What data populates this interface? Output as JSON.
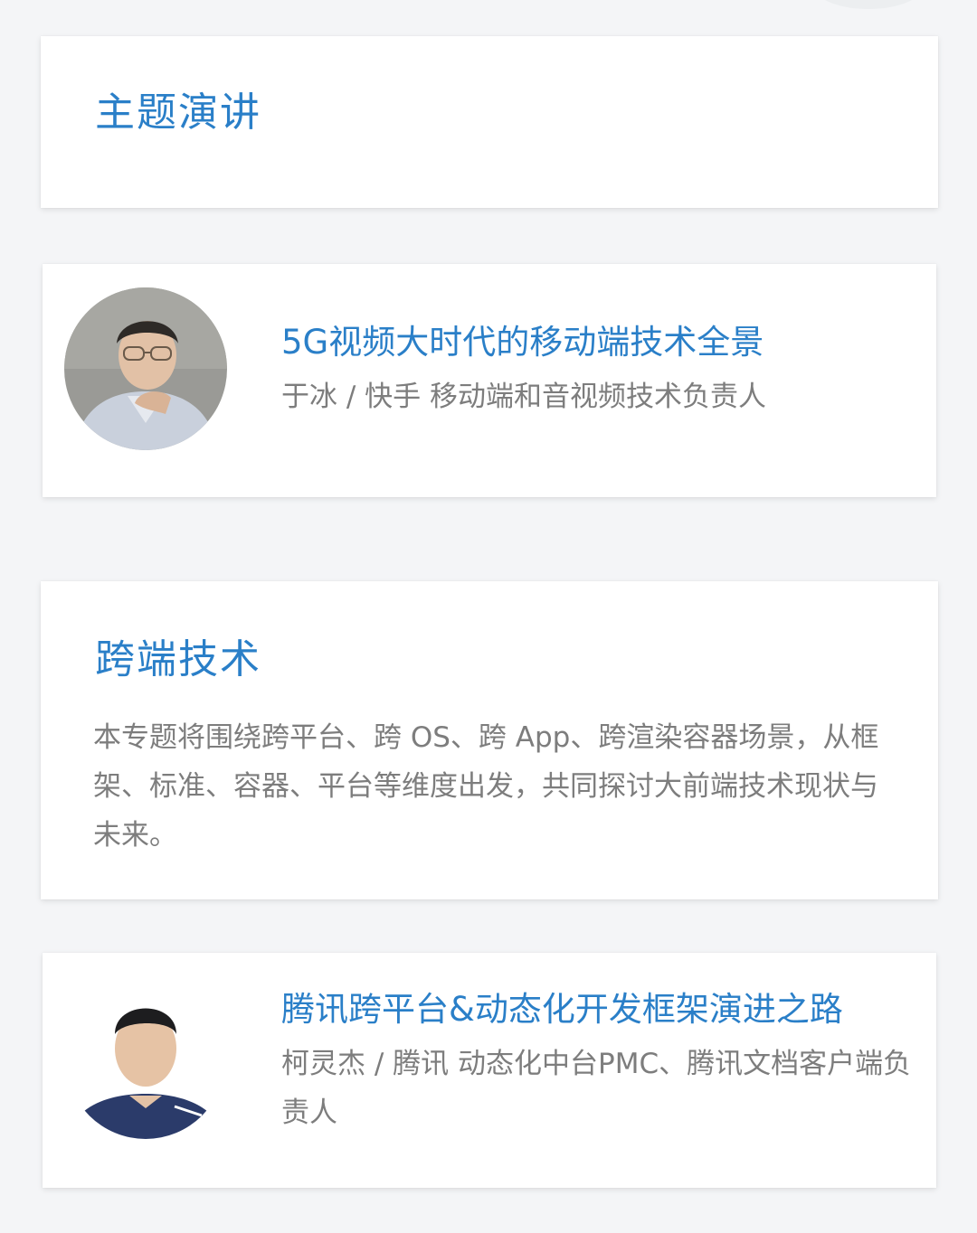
{
  "sections": [
    {
      "title": "主题演讲",
      "talks": [
        {
          "title": "5G视频大时代的移动端技术全景",
          "speaker": "于冰 / 快手 移动端和音视频技术负责人"
        }
      ]
    },
    {
      "title": "跨端技术",
      "description": "本专题将围绕跨平台、跨 OS、跨 App、跨渲染容器场景，从框架、标准、容器、平台等维度出发，共同探讨大前端技术现状与未来。",
      "talks": [
        {
          "title": "腾讯跨平台&动态化开发框架演进之路",
          "speaker": "柯灵杰 / 腾讯 动态化中台PMC、腾讯文档客户端负责人"
        }
      ]
    }
  ],
  "colors": {
    "accent": "#2a7fc8",
    "text_muted": "#7d7d7d",
    "background": "#f4f5f7",
    "card": "#ffffff"
  }
}
